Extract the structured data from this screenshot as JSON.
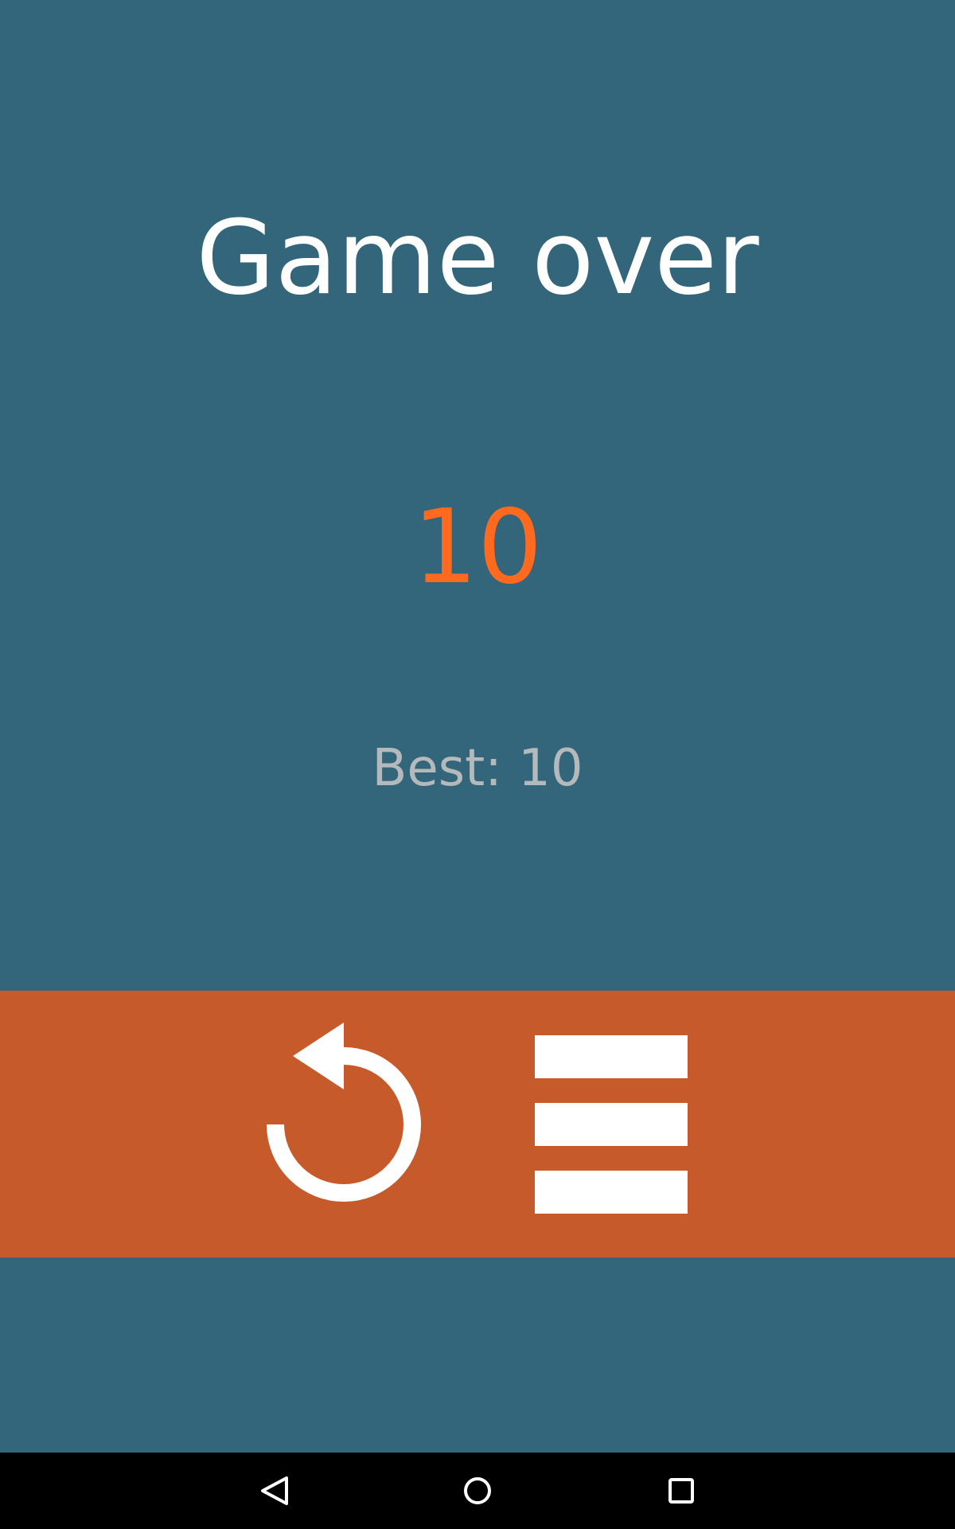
{
  "screen": {
    "title": "Game over",
    "score": "10",
    "best_label": "Best: 10"
  },
  "actions": {
    "replay_icon": "replay-icon",
    "menu_icon": "menu-icon"
  },
  "navbar": {
    "back_icon": "back-triangle-icon",
    "home_icon": "home-circle-icon",
    "recent_icon": "recent-apps-square-icon"
  },
  "colors": {
    "background": "#33667B",
    "score": "#FF6A1F",
    "best": "#B4B9BC",
    "action_bar": "#C65A2A",
    "navbar": "#000000"
  }
}
